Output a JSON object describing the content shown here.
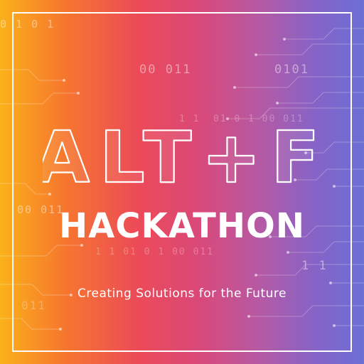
{
  "title": "ALT+F",
  "subtitle": "HACKATHON",
  "tagline": "Creating Solutions for the Future",
  "binary_snippets": [
    "0 1  0  1",
    "00  011",
    "0101",
    "1 1",
    "01  0  1   00  011",
    "00  011",
    "1 1     01  0  1   00  011",
    "1  1",
    "011"
  ],
  "colors": {
    "gradient_start": "#fbb11a",
    "gradient_mid": "#e8475e",
    "gradient_end": "#6b6fd6",
    "text": "#ffffff"
  }
}
